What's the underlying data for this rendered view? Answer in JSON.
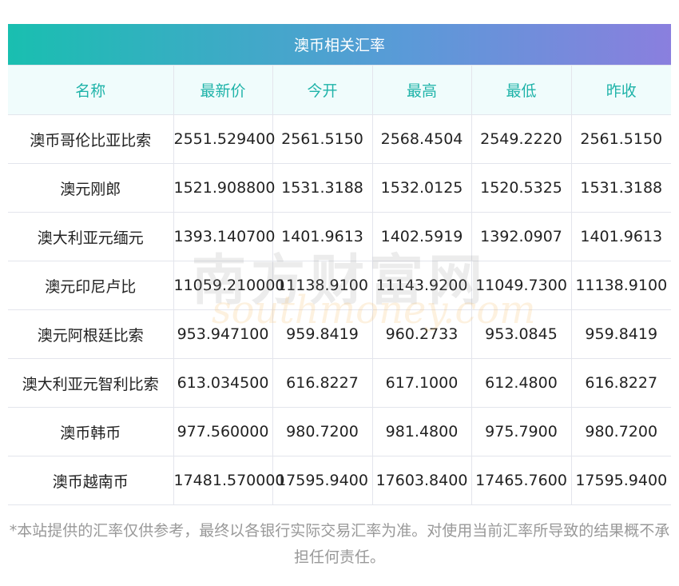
{
  "title": "澳币相关汇率",
  "headers": [
    "名称",
    "最新价",
    "今开",
    "最高",
    "最低",
    "昨收"
  ],
  "rows": [
    [
      "澳币哥伦比亚比索",
      "2551.529400",
      "2561.5150",
      "2568.4504",
      "2549.2220",
      "2561.5150"
    ],
    [
      "澳元刚郎",
      "1521.908800",
      "1531.3188",
      "1532.0125",
      "1520.5325",
      "1531.3188"
    ],
    [
      "澳大利亚元缅元",
      "1393.140700",
      "1401.9613",
      "1402.5919",
      "1392.0907",
      "1401.9613"
    ],
    [
      "澳元印尼卢比",
      "11059.210000",
      "11138.9100",
      "11143.9200",
      "11049.7300",
      "11138.9100"
    ],
    [
      "澳元阿根廷比索",
      "953.947100",
      "959.8419",
      "960.2733",
      "953.0845",
      "959.8419"
    ],
    [
      "澳大利亚元智利比索",
      "613.034500",
      "616.8227",
      "617.1000",
      "612.4800",
      "616.8227"
    ],
    [
      "澳币韩币",
      "977.560000",
      "980.7200",
      "981.4800",
      "975.7900",
      "980.7200"
    ],
    [
      "澳币越南币",
      "17481.570000",
      "17595.9400",
      "17603.8400",
      "17465.7600",
      "17595.9400"
    ]
  ],
  "watermark": {
    "cn": "南方财富网",
    "en": "southmoney.com"
  },
  "note": "*本站提供的汇率仅供参考，最终以各银行实际交易汇率为准。对使用当前汇率所导致的结果概不承担任何责任。"
}
